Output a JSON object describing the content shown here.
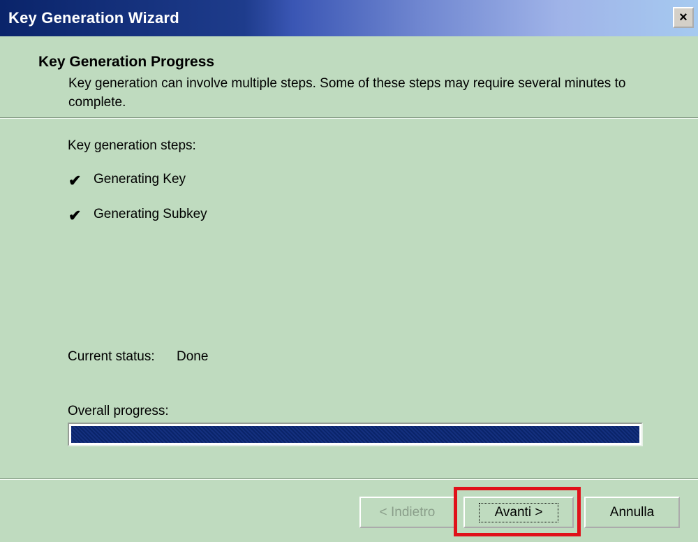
{
  "window": {
    "title": "Key Generation Wizard",
    "close_label": "×"
  },
  "header": {
    "title": "Key Generation Progress",
    "subtitle": "Key generation can involve multiple steps.  Some of these steps may require several minutes to complete."
  },
  "steps": {
    "heading": "Key generation steps:",
    "items": [
      {
        "label": "Generating Key",
        "done": true
      },
      {
        "label": "Generating Subkey",
        "done": true
      }
    ]
  },
  "status": {
    "label": "Current status:",
    "value": "Done"
  },
  "progress": {
    "label": "Overall progress:",
    "percent": 100
  },
  "buttons": {
    "back": "< Indietro",
    "next": "Avanti >",
    "cancel": "Annulla"
  },
  "colors": {
    "background": "#bfdbbf",
    "title_bar": "#0a246a",
    "progress_fill": "#0a246a",
    "highlight": "#e0111a"
  },
  "icons": {
    "check": "checkmark-icon",
    "close": "close-icon"
  }
}
